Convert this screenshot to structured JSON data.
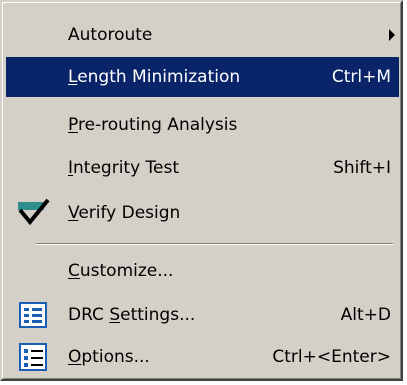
{
  "menu": {
    "items": [
      {
        "label": "Autoroute",
        "mnemonic": "",
        "accel": "",
        "submenu": true
      },
      {
        "label": "Length Minimization",
        "mnemonic": "L",
        "accel": "Ctrl+M",
        "selected": true
      },
      {
        "label": "Pre-routing Analysis",
        "mnemonic": "P",
        "accel": ""
      },
      {
        "label": "Integrity Test",
        "mnemonic": "I",
        "accel": "Shift+I"
      },
      {
        "label": "Verify Design",
        "mnemonic": "V",
        "accel": "",
        "icon": "verify-check-icon"
      },
      {
        "label": "Customize...",
        "mnemonic": "C",
        "accel": ""
      },
      {
        "label": "DRC Settings...",
        "mnemonic": "S",
        "accel": "Alt+D",
        "icon": "drc-settings-icon"
      },
      {
        "label": "Options...",
        "mnemonic": "O",
        "accel": "Ctrl+<Enter>",
        "icon": "options-list-icon"
      }
    ],
    "colors": {
      "background": "#d4d0c8",
      "selection": "#0a246a",
      "selection_text": "#ffffff"
    }
  }
}
